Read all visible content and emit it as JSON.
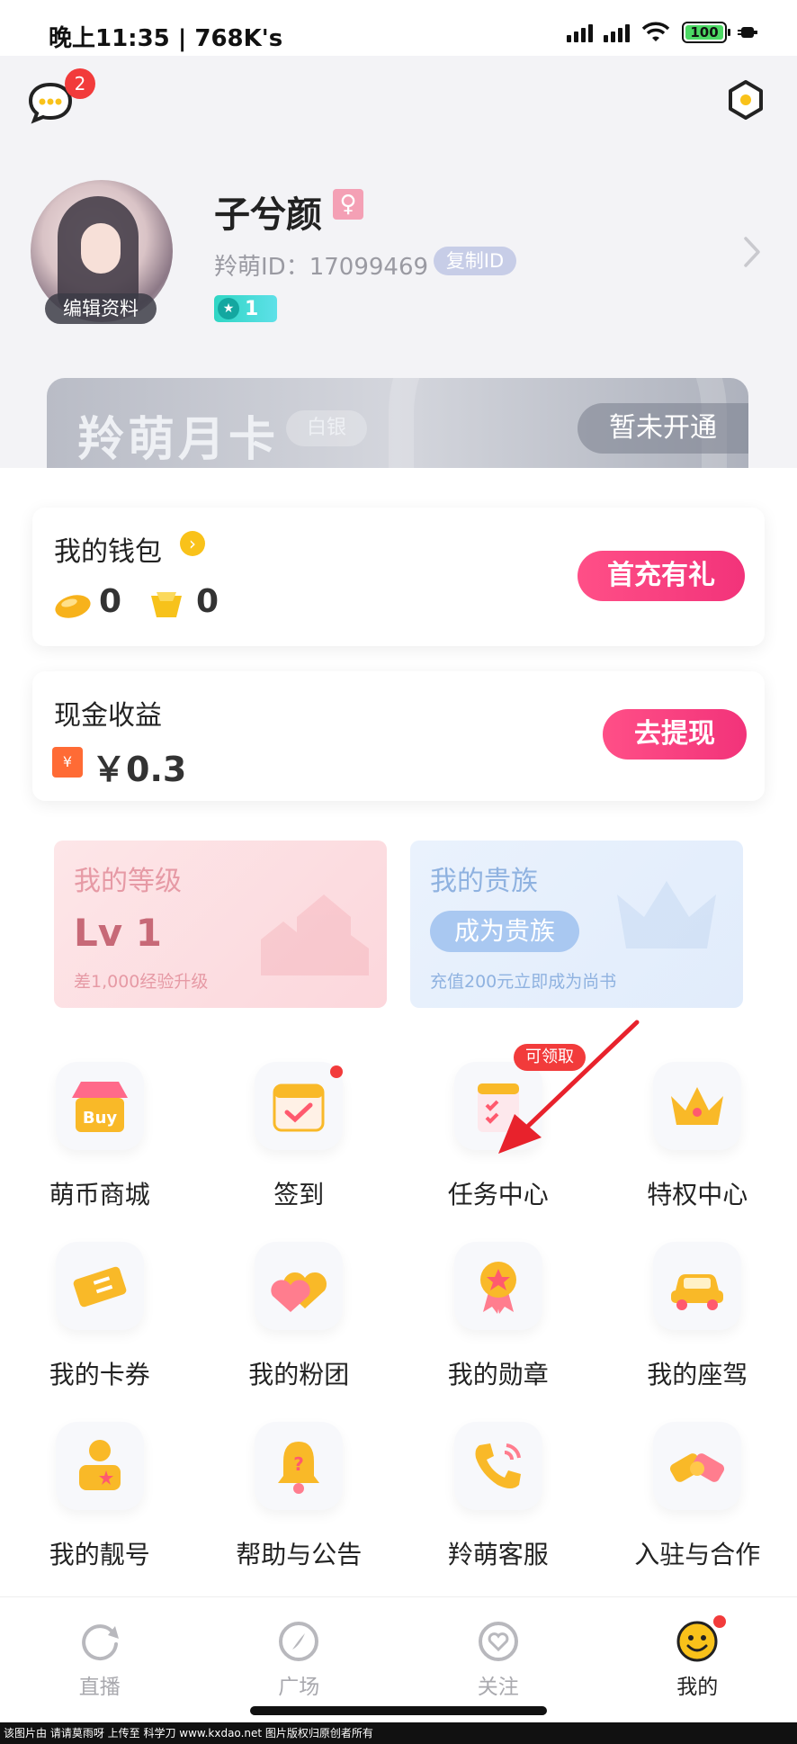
{
  "status_bar": {
    "time": "晚上11:35 | 768K's",
    "battery": "100"
  },
  "header": {
    "message_badge": "2"
  },
  "profile": {
    "name": "子兮颜",
    "gender_symbol": "♀",
    "id_text": "羚萌ID：17099469",
    "copy_id": "复制ID",
    "edit_profile": "编辑资料",
    "level": "1"
  },
  "month_card": {
    "title": "羚萌月卡",
    "tier": "白银",
    "status": "暂未开通"
  },
  "wallet": {
    "title": "我的钱包",
    "bean_value": "0",
    "coin_value": "0",
    "button": "首充有礼"
  },
  "cash": {
    "title": "现金收益",
    "icon_text": "¥",
    "value": "￥0.3",
    "button": "去提现"
  },
  "level_card": {
    "title": "我的等级",
    "value": "Lv 1",
    "subtitle": "差1,000经验升级"
  },
  "noble_card": {
    "title": "我的贵族",
    "button": "成为贵族",
    "subtitle": "充值200元立即成为尚书"
  },
  "grid": {
    "items": [
      {
        "label": "萌币商城",
        "icon": "shop-icon"
      },
      {
        "label": "签到",
        "icon": "calendar-check-icon"
      },
      {
        "label": "任务中心",
        "icon": "task-list-icon",
        "badge": "可领取"
      },
      {
        "label": "特权中心",
        "icon": "crown-icon"
      },
      {
        "label": "我的卡券",
        "icon": "ticket-icon"
      },
      {
        "label": "我的粉团",
        "icon": "hearts-icon"
      },
      {
        "label": "我的勋章",
        "icon": "medal-icon"
      },
      {
        "label": "我的座驾",
        "icon": "car-icon"
      },
      {
        "label": "我的靓号",
        "icon": "vip-user-icon"
      },
      {
        "label": "帮助与公告",
        "icon": "bell-icon"
      },
      {
        "label": "羚萌客服",
        "icon": "phone-icon"
      },
      {
        "label": "入驻与合作",
        "icon": "handshake-icon"
      }
    ]
  },
  "bottom_nav": {
    "items": [
      {
        "label": "直播",
        "icon": "live-icon"
      },
      {
        "label": "广场",
        "icon": "compass-icon"
      },
      {
        "label": "关注",
        "icon": "follow-heart-icon"
      },
      {
        "label": "我的",
        "icon": "smiley-icon"
      }
    ]
  },
  "footer": {
    "text": "该图片由 请请莫雨呀 上传至 科学刀 www.kxdao.net 图片版权归原创者所有"
  },
  "colors": {
    "accent_pink": "#f2337a",
    "badge_red": "#f23b3b",
    "level_teal": "#2fd6c4",
    "noble_blue": "#a9c8f1"
  }
}
